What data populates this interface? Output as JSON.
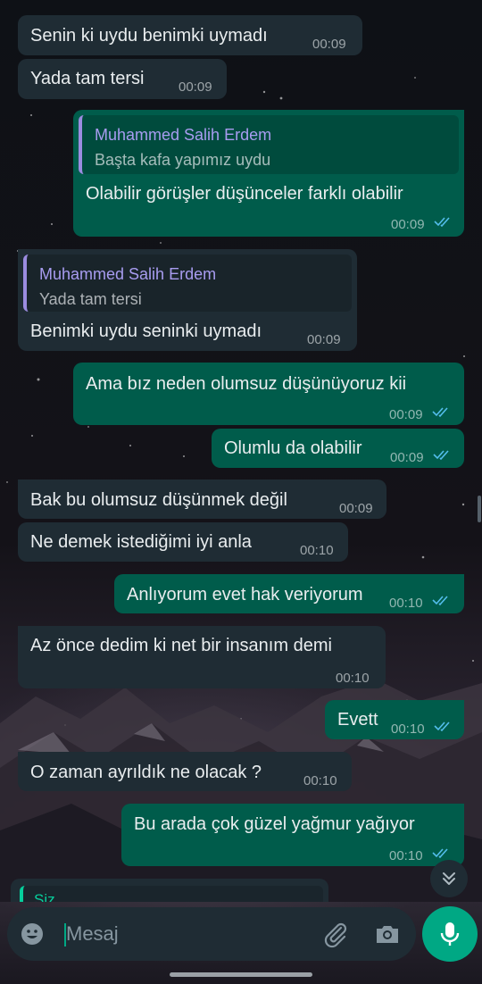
{
  "messages": [
    {
      "dir": "in",
      "text": "Senin ki uydu benimki uymadı",
      "time": "00:09"
    },
    {
      "dir": "in",
      "text": "Yada tam tersi",
      "time": "00:09"
    },
    {
      "dir": "out",
      "quote_name": "Muhammed Salih Erdem",
      "quote_text": "Başta kafa yapımız uydu",
      "text": "Olabilir görüşler düşünceler farklı olabilir",
      "time": "00:09"
    },
    {
      "dir": "in",
      "quote_name": "Muhammed Salih Erdem",
      "quote_text": "Yada tam tersi",
      "text": "Benimki uydu seninki uymadı",
      "time": "00:09"
    },
    {
      "dir": "out",
      "text": "Ama bız neden olumsuz düşünüyoruz kii",
      "time": "00:09"
    },
    {
      "dir": "out",
      "text": "Olumlu da olabilir",
      "time": "00:09"
    },
    {
      "dir": "in",
      "text": "Bak bu olumsuz düşünmek değil",
      "time": "00:09"
    },
    {
      "dir": "in",
      "text": "Ne demek istediğimi iyi anla",
      "time": "00:10"
    },
    {
      "dir": "out",
      "text": "Anlıyorum evet hak veriyorum",
      "time": "00:10"
    },
    {
      "dir": "in",
      "text": "Az önce dedim ki net bir insanım demi",
      "time": "00:10"
    },
    {
      "dir": "out",
      "text": "Evett",
      "time": "00:10"
    },
    {
      "dir": "in",
      "text": "O zaman ayrıldık ne olacak ?",
      "time": "00:10"
    },
    {
      "dir": "out",
      "text": "Bu arada çok güzel yağmur yağıyor",
      "time": "00:10"
    }
  ],
  "partial_reply": {
    "quote_name": "Siz"
  },
  "composer": {
    "placeholder": "Mesaj"
  },
  "icons": {
    "emoji": "emoji-icon",
    "attach": "paperclip-icon",
    "camera": "camera-icon",
    "mic": "microphone-icon",
    "scroll": "chevron-double-down-icon",
    "read": "double-check-icon"
  },
  "colors": {
    "incoming_bubble": "#1f2c34",
    "outgoing_bubble": "#005c4b",
    "accent": "#00a884",
    "read_ticks": "#53bdeb",
    "quote_name": "#a89cf0"
  }
}
